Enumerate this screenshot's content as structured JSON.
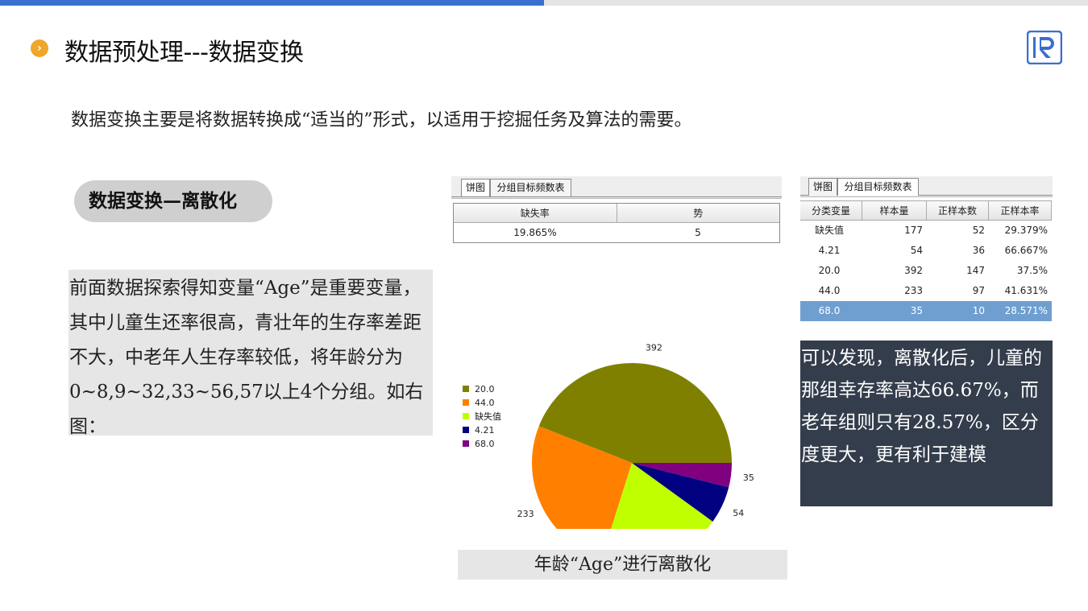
{
  "header": {
    "title": "数据预处理---数据变换",
    "bullet_icon": "chevron-right-icon",
    "logo_icon": "r-logo-icon",
    "accent_color": "#3a6fd0",
    "bullet_color": "#f0a62a"
  },
  "intro": "数据变换主要是将数据转换成“适当的”形式，以适用于挖掘任务及算法的需要。",
  "section_label": "数据变换—离散化",
  "paragraph": "前面数据探索得知变量“Age”是重要变量，其中儿童生还率很高，青壮年的生存率差距不大，中老年人生存率较低，将年龄分为0~8,9~32,33~56,57以上4个分组。如右图：",
  "left_panel": {
    "tabs": [
      "饼图",
      "分组目标频数表"
    ],
    "active_tab": 0,
    "table": {
      "headers": [
        "缺失率",
        "势"
      ],
      "row": [
        "19.865%",
        "5"
      ]
    }
  },
  "chart_data": {
    "type": "pie",
    "title": "",
    "slices": [
      {
        "name": "20.0",
        "value": 392,
        "color": "#808000"
      },
      {
        "name": "44.0",
        "value": 233,
        "color": "#ff8000"
      },
      {
        "name": "缺失值",
        "value": 177,
        "color": "#c0ff00"
      },
      {
        "name": "4.21",
        "value": 54,
        "color": "#000080"
      },
      {
        "name": "68.0",
        "value": 35,
        "color": "#800080"
      }
    ],
    "legend": [
      "20.0",
      "44.0",
      "缺失值",
      "4.21",
      "68.0"
    ],
    "legend_position": "left"
  },
  "caption": "年龄“Age”进行离散化",
  "right_panel": {
    "tabs": [
      "饼图",
      "分组目标频数表"
    ],
    "active_tab": 1,
    "headers": [
      "分类变量",
      "样本量",
      "正样本数",
      "正样本率"
    ],
    "rows": [
      [
        "缺失值",
        "177",
        "52",
        "29.379%"
      ],
      [
        "4.21",
        "54",
        "36",
        "66.667%"
      ],
      [
        "20.0",
        "392",
        "147",
        "37.5%"
      ],
      [
        "44.0",
        "233",
        "97",
        "41.631%"
      ],
      [
        "68.0",
        "35",
        "10",
        "28.571%"
      ]
    ],
    "selected_row": 4,
    "selected_color": "#6f9fd0"
  },
  "note": "可以发现，离散化后，儿童的那组幸存率高达66.67%，而老年组则只有28.57%，区分度更大，更有利于建模"
}
